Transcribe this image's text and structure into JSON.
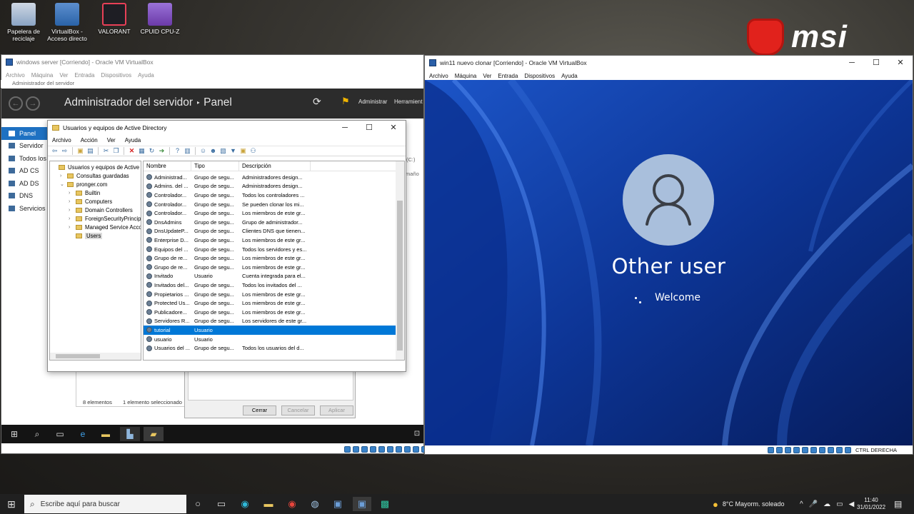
{
  "desktop": {
    "icons": [
      {
        "label": "Papelera de reciclaje",
        "icon": "recycle-bin-icon",
        "color": "#8aa4c4"
      },
      {
        "label": "VirtualBox - Acceso directo",
        "icon": "virtualbox-icon",
        "color": "#2a63a8"
      },
      {
        "label": "VALORANT",
        "icon": "valorant-icon",
        "color": "#e84057"
      },
      {
        "label": "CPUID CPU-Z",
        "icon": "cpuz-icon",
        "color": "#6b3aa8"
      }
    ],
    "brand": "msi"
  },
  "vm_server": {
    "title": "windows server [Corriendo] - Oracle VM VirtualBox",
    "menu": [
      "Archivo",
      "Máquina",
      "Ver",
      "Entrada",
      "Dispositivos",
      "Ayuda"
    ],
    "server_manager": {
      "app_title": "Administrador del servidor",
      "breadcrumb_sep": "‣",
      "page": "Panel",
      "header_actions": [
        "Administrar",
        "Herramient"
      ],
      "sidebar": [
        "Panel",
        "Servidor",
        "Todos los",
        "AD CS",
        "AD DS",
        "DNS",
        "Servicios"
      ],
      "footer": {
        "count": "8 elementos",
        "selected": "1 elemento seleccionado"
      },
      "fragments": [
        "(C:)",
        "maño"
      ]
    },
    "ad_window": {
      "title": "Usuarios y equipos de Active Directory",
      "menu": [
        "Archivo",
        "Acción",
        "Ver",
        "Ayuda"
      ],
      "tree": [
        {
          "label": "Usuarios y equipos de Active Dir",
          "level": 0,
          "exp": ""
        },
        {
          "label": "Consultas guardadas",
          "level": 1,
          "exp": "›"
        },
        {
          "label": "pronger.com",
          "level": 1,
          "exp": "⌄"
        },
        {
          "label": "Builtin",
          "level": 2,
          "exp": "›"
        },
        {
          "label": "Computers",
          "level": 2,
          "exp": "›"
        },
        {
          "label": "Domain Controllers",
          "level": 2,
          "exp": "›"
        },
        {
          "label": "ForeignSecurityPrincipals",
          "level": 2,
          "exp": "›"
        },
        {
          "label": "Managed Service Accoun",
          "level": 2,
          "exp": "›"
        },
        {
          "label": "Users",
          "level": 2,
          "exp": "",
          "selected": true
        }
      ],
      "columns": [
        "Nombre",
        "Tipo",
        "Descripción"
      ],
      "rows": [
        [
          "Administrad...",
          "Grupo de segu...",
          "Administradores design..."
        ],
        [
          "Admins. del ...",
          "Grupo de segu...",
          "Administradores design..."
        ],
        [
          "Controlador...",
          "Grupo de segu...",
          "Todos los controladores ..."
        ],
        [
          "Controlador...",
          "Grupo de segu...",
          "Se pueden clonar los mi..."
        ],
        [
          "Controlador...",
          "Grupo de segu...",
          "Los miembros de este gr..."
        ],
        [
          "DnsAdmins",
          "Grupo de segu...",
          "Grupo de administrador..."
        ],
        [
          "DnsUpdateP...",
          "Grupo de segu...",
          "Clientes DNS que tienen..."
        ],
        [
          "Enterprise D...",
          "Grupo de segu...",
          "Los miembros de este gr..."
        ],
        [
          "Equipos del ...",
          "Grupo de segu...",
          "Todos los servidores y es..."
        ],
        [
          "Grupo de re...",
          "Grupo de segu...",
          "Los miembros de este gr..."
        ],
        [
          "Grupo de re...",
          "Grupo de segu...",
          "Los miembros de este gr..."
        ],
        [
          "Invitado",
          "Usuario",
          "Cuenta integrada para el..."
        ],
        [
          "Invitados del...",
          "Grupo de segu...",
          "Todos los invitados del ..."
        ],
        [
          "Propietarios ...",
          "Grupo de segu...",
          "Los miembros de este gr..."
        ],
        [
          "Protected Us...",
          "Grupo de segu...",
          "Los miembros de este gr..."
        ],
        [
          "Publicadore...",
          "Grupo de segu...",
          "Los miembros de este gr..."
        ],
        [
          "Servidores R...",
          "Grupo de segu...",
          "Los servidores de este gr..."
        ],
        [
          "tutorial",
          "Usuario",
          ""
        ],
        [
          "usuario",
          "Usuario",
          ""
        ],
        [
          "Usuarios del ...",
          "Grupo de segu...",
          "Todos los usuarios del d..."
        ]
      ],
      "selected_row": 17
    },
    "dialog_buttons": [
      "Cerrar",
      "Cancelar",
      "Aplicar"
    ]
  },
  "vm_win11": {
    "title": "win11 nuevo clonar [Corriendo] - Oracle VM VirtualBox",
    "menu": [
      "Archivo",
      "Máquina",
      "Ver",
      "Entrada",
      "Dispositivos",
      "Ayuda"
    ],
    "user": "Other user",
    "status": "Welcome",
    "host_key": "CTRL DERECHA"
  },
  "host_taskbar": {
    "search_placeholder": "Escribe aquí para buscar",
    "weather": "8°C  Mayorm. soleado",
    "time": "11:40",
    "date": "31/01/2022"
  },
  "colors": {
    "accent": "#0078d7",
    "win11_bg": "#0a2a7a"
  }
}
